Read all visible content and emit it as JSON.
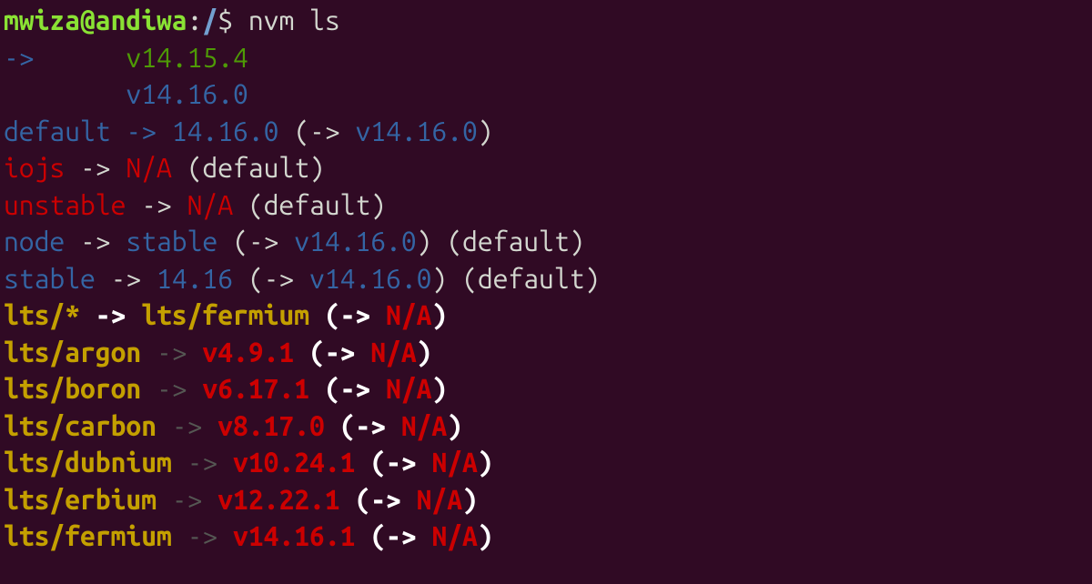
{
  "prompt": {
    "user_host": "mwiza@andiwa",
    "colon": ":",
    "path": "/",
    "dollar": "$ ",
    "command": "nvm ls"
  },
  "lines": {
    "l1_pad": "->      ",
    "l1_ver": "v14.15.4",
    "l2_pad": "        ",
    "l2_ver": "v14.16.0",
    "l3_alias": "default",
    "l3_arrow": " -> ",
    "l3_target": "14.16.0",
    "l3_open": " (",
    "l3_arrow2": "-> ",
    "l3_resolved": "v14.16.0",
    "l3_close": ")",
    "l4_alias": "iojs",
    "l4_arrow": " -> ",
    "l4_target": "N/A",
    "l4_note": " (default)",
    "l5_alias": "unstable",
    "l5_arrow": " -> ",
    "l5_target": "N/A",
    "l5_note": " (default)",
    "l6_alias": "node",
    "l6_arrow": " -> ",
    "l6_target": "stable",
    "l6_open": " (",
    "l6_arrow2": "-> ",
    "l6_resolved": "v14.16.0",
    "l6_close": ")",
    "l6_note": " (default)",
    "l7_alias": "stable",
    "l7_arrow": " -> ",
    "l7_target": "14.16",
    "l7_open": " (",
    "l7_arrow2": "-> ",
    "l7_resolved": "v14.16.0",
    "l7_close": ")",
    "l7_note": " (default)",
    "l8_alias": "lts/*",
    "l8_arrow": " -> ",
    "l8_target": "lts/fermium",
    "l8_open": " (",
    "l8_arrow2": "-> ",
    "l8_na": "N/A",
    "l8_close": ")",
    "l9_alias": "lts/argon",
    "l9_arrow": " -> ",
    "l9_target": "v4.9.1",
    "l9_open": " (",
    "l9_arrow2": "-> ",
    "l9_na": "N/A",
    "l9_close": ")",
    "l10_alias": "lts/boron",
    "l10_arrow": " -> ",
    "l10_target": "v6.17.1",
    "l10_open": " (",
    "l10_arrow2": "-> ",
    "l10_na": "N/A",
    "l10_close": ")",
    "l11_alias": "lts/carbon",
    "l11_arrow": " -> ",
    "l11_target": "v8.17.0",
    "l11_open": " (",
    "l11_arrow2": "-> ",
    "l11_na": "N/A",
    "l11_close": ")",
    "l12_alias": "lts/dubnium",
    "l12_arrow": " -> ",
    "l12_target": "v10.24.1",
    "l12_open": " (",
    "l12_arrow2": "-> ",
    "l12_na": "N/A",
    "l12_close": ")",
    "l13_alias": "lts/erbium",
    "l13_arrow": " -> ",
    "l13_target": "v12.22.1",
    "l13_open": " (",
    "l13_arrow2": "-> ",
    "l13_na": "N/A",
    "l13_close": ")",
    "l14_alias": "lts/fermium",
    "l14_arrow": " -> ",
    "l14_target": "v14.16.1",
    "l14_open": " (",
    "l14_arrow2": "-> ",
    "l14_na": "N/A",
    "l14_close": ")"
  }
}
